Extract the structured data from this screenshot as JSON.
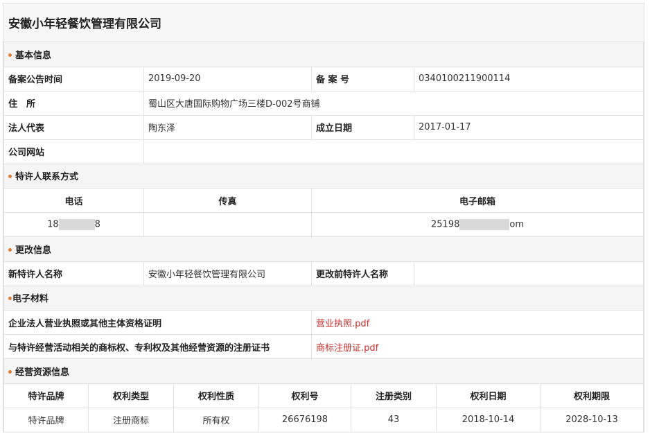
{
  "company": {
    "name": "安徽小年轻餐饮管理有限公司"
  },
  "basic": {
    "section_title": "基本信息",
    "announce_date_label": "备案公告时间",
    "announce_date": "2019-09-20",
    "record_no_label": "备 案 号",
    "record_no": "0340100211900114",
    "address_label": "住　所",
    "address": "蜀山区大唐国际购物广场三楼D-002号商铺",
    "legal_rep_label": "法人代表",
    "legal_rep": "陶东泽",
    "founded_label": "成立日期",
    "founded": "2017-01-17",
    "website_label": "公司网站",
    "website": ""
  },
  "contact": {
    "section_title": "特许人联系方式",
    "phone_header": "电话",
    "fax_header": "传真",
    "email_header": "电子邮箱",
    "phone_start": "18",
    "phone_end": "8",
    "fax": "",
    "email_start": "25198",
    "email_end": "om"
  },
  "change": {
    "section_title": "更改信息",
    "new_name_label": "新特许人名称",
    "new_name": "安徽小年轻餐饮管理有限公司",
    "old_name_label": "更改前特许人名称",
    "old_name": ""
  },
  "materials": {
    "section_title": "电子材料",
    "license_label": "企业法人营业执照或其他主体资格证明",
    "license_file": "营业执照.pdf",
    "trademark_label": "与特许经营活动相关的商标权、专利权及其他经营资源的注册证书",
    "trademark_file": "商标注册证.pdf"
  },
  "resources": {
    "section_title": "经营资源信息",
    "headers": [
      "特许品牌",
      "权利类型",
      "权利性质",
      "权利号",
      "注册类别",
      "权利日期",
      "权利期限"
    ],
    "rows": [
      [
        "特许品牌",
        "注册商标",
        "所有权",
        "26676198",
        "43",
        "2018-10-14",
        "2028-10-13"
      ]
    ]
  },
  "colors": {
    "accent_dot": "#e47a2e",
    "link_red": "#c9302c",
    "section_bg": "#f5f5f5"
  }
}
